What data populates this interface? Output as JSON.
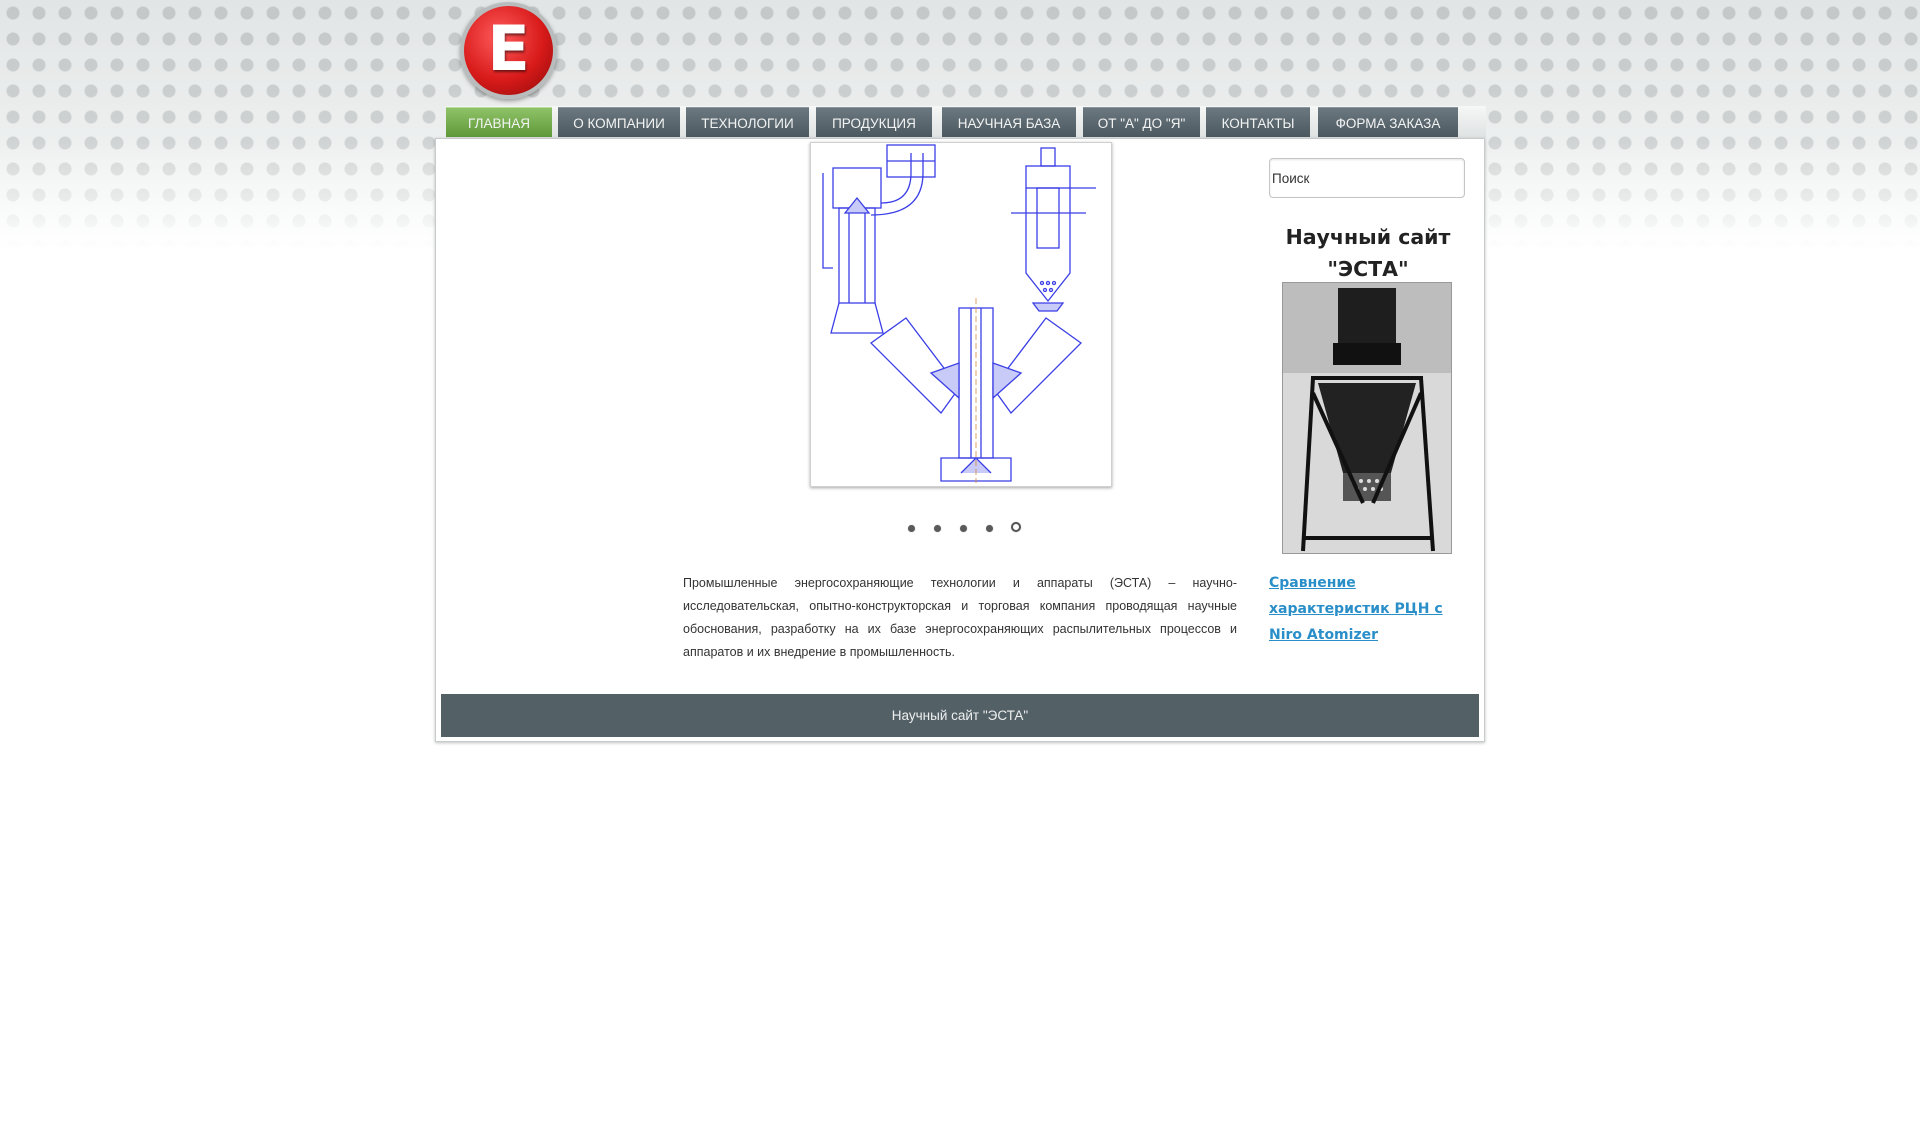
{
  "logo": {
    "letter": "E"
  },
  "nav": {
    "items": [
      {
        "label": "ГЛАВНАЯ",
        "active": true
      },
      {
        "label": "О КОМПАНИИ",
        "active": false
      },
      {
        "label": "ТЕХНОЛОГИИ",
        "active": false
      },
      {
        "label": "ПРОДУКЦИЯ",
        "active": false
      },
      {
        "label": "НАУЧНАЯ БАЗА",
        "active": false
      },
      {
        "label": "ОТ \"А\" ДО \"Я\"",
        "active": false
      },
      {
        "label": "КОНТАКТЫ",
        "active": false
      },
      {
        "label": "ФОРМА ЗАКАЗА",
        "active": false
      }
    ]
  },
  "slider": {
    "slide_count": 5,
    "active_index": 4
  },
  "main": {
    "intro": "Промышленные энергосохраняющие технологии и аппараты (ЭСТА) – научно-исследовательская, опытно-конструкторская и торговая компания проводящая научные обоснования, разработку на их базе энергосохраняющих распылительных процессов и аппаратов и их внедрение в промышленность."
  },
  "sidebar": {
    "search_placeholder": "Поиск",
    "title": "Научный сайт \"ЭСТА\"",
    "link": "Сравнение характеристик РЦН с Niro Atomizer"
  },
  "footer": {
    "text": "Научный сайт \"ЭСТА\""
  },
  "colors": {
    "nav_bg": "#536066",
    "nav_active": "#6fa845",
    "link": "#2a8fc9",
    "logo_red": "#d81a1a"
  }
}
